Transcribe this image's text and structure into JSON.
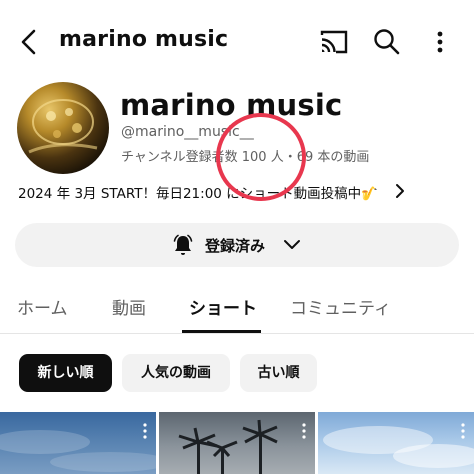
{
  "topbar": {
    "title": "marino music",
    "icons": [
      "back-arrow-icon",
      "cast-icon",
      "search-icon",
      "more-vert-icon"
    ]
  },
  "channel": {
    "name": "marino music",
    "handle": "@marino__music__",
    "stats": "チャンネル登録者数 100 人・69 本の動画",
    "description": "2024 年 3月 START！毎日21:00 にショート動画投稿中🎷"
  },
  "subscribe": {
    "label": "登録済み",
    "icons": [
      "bell-icon",
      "chevron-down-icon"
    ]
  },
  "tabs": [
    {
      "label": "ホーム",
      "active": false
    },
    {
      "label": "動画",
      "active": false
    },
    {
      "label": "ショート",
      "active": true
    },
    {
      "label": "コミュニティ",
      "active": false
    }
  ],
  "sort_chips": [
    {
      "label": "新しい順",
      "selected": true
    },
    {
      "label": "人気の動画",
      "selected": false
    },
    {
      "label": "古い順",
      "selected": false
    }
  ],
  "colors": {
    "text_primary": "#0f0f0f",
    "text_secondary": "#606060",
    "chip_bg": "#f2f2f2",
    "annotation_red": "#e8374e"
  }
}
